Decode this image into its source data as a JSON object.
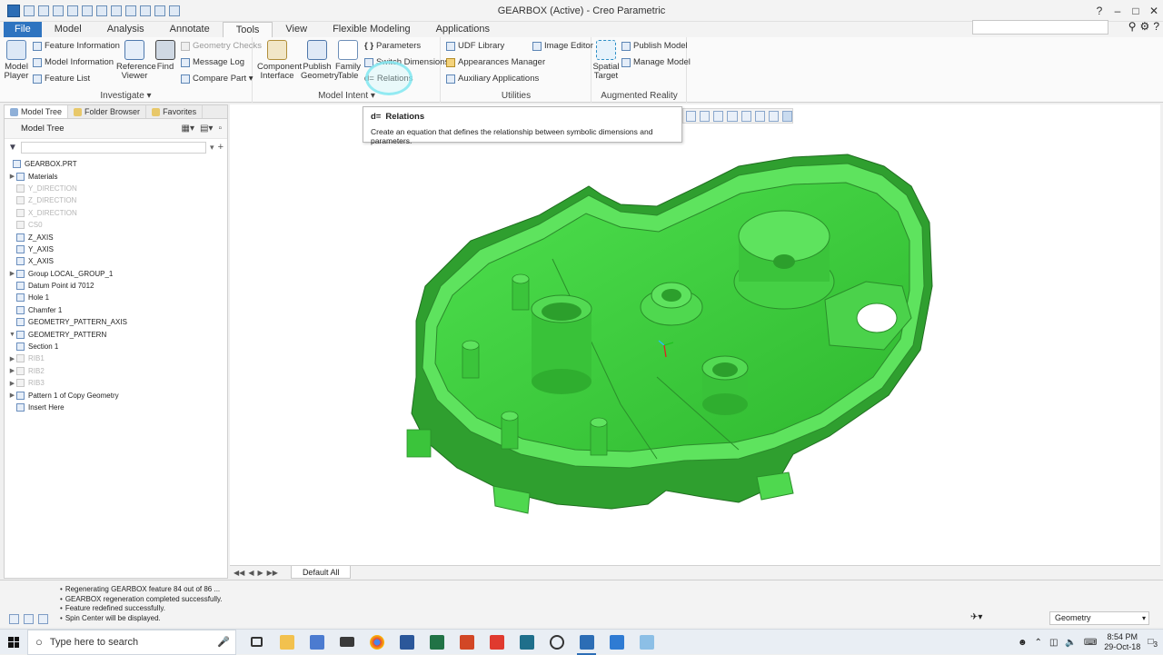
{
  "window": {
    "title": "GEARBOX (Active) - Creo Parametric",
    "controls": [
      "?",
      "–",
      "□",
      "✕"
    ]
  },
  "menu": {
    "tabs": [
      "File",
      "Model",
      "Analysis",
      "Annotate",
      "Tools",
      "View",
      "Flexible Modeling",
      "Applications"
    ],
    "active": "Tools"
  },
  "ribbon": {
    "investigate": {
      "title": "Investigate ▾",
      "model_player": "Model Player",
      "feature_information": "Feature Information",
      "model_information": "Model Information",
      "feature_list": "Feature List",
      "reference_viewer": "Reference Viewer",
      "find": "Find",
      "geometry_checks": "Geometry Checks",
      "message_log": "Message Log",
      "compare_part": "Compare Part ▾"
    },
    "model_intent": {
      "title": "Model Intent ▾",
      "component_interface": "Component Interface",
      "publish_geometry": "Publish Geometry",
      "family_table": "Family Table",
      "parameters": "Parameters",
      "switch_dimensions": "Switch Dimensions",
      "relations": "Relations"
    },
    "utilities": {
      "title": "Utilities",
      "udf_library": "UDF Library",
      "image_editor": "Image Editor",
      "appearances_manager": "Appearances Manager",
      "auxiliary_applications": "Auxiliary Applications"
    },
    "augmented_reality": {
      "title": "Augmented Reality",
      "spatial_target": "Spatial Target",
      "publish_model": "Publish Model",
      "manage_model": "Manage Model"
    }
  },
  "tooltip": {
    "title": "Relations",
    "description": "Create an equation that defines the relationship between symbolic dimensions and parameters."
  },
  "leftpanel": {
    "tabs": [
      "Model Tree",
      "Folder Browser",
      "Favorites"
    ],
    "header": "Model Tree",
    "tree": [
      {
        "label": "GEARBOX.PRT",
        "dim": false,
        "exp": ""
      },
      {
        "label": "Materials",
        "dim": false,
        "exp": "▶"
      },
      {
        "label": "Y_DIRECTION",
        "dim": true,
        "exp": ""
      },
      {
        "label": "Z_DIRECTION",
        "dim": true,
        "exp": ""
      },
      {
        "label": "X_DIRECTION",
        "dim": true,
        "exp": ""
      },
      {
        "label": "CS0",
        "dim": true,
        "exp": ""
      },
      {
        "label": "Z_AXIS",
        "dim": false,
        "exp": ""
      },
      {
        "label": "Y_AXIS",
        "dim": false,
        "exp": ""
      },
      {
        "label": "X_AXIS",
        "dim": false,
        "exp": ""
      },
      {
        "label": "Group LOCAL_GROUP_1",
        "dim": false,
        "exp": "▶"
      },
      {
        "label": "Datum Point id 7012",
        "dim": false,
        "exp": ""
      },
      {
        "label": "Hole 1",
        "dim": false,
        "exp": ""
      },
      {
        "label": "Chamfer 1",
        "dim": false,
        "exp": ""
      },
      {
        "label": "GEOMETRY_PATTERN_AXIS",
        "dim": false,
        "exp": ""
      },
      {
        "label": "GEOMETRY_PATTERN",
        "dim": false,
        "exp": "▼"
      },
      {
        "label": "Section 1",
        "dim": false,
        "exp": ""
      },
      {
        "label": "RIB1",
        "dim": true,
        "exp": "▶"
      },
      {
        "label": "RIB2",
        "dim": true,
        "exp": "▶"
      },
      {
        "label": "RIB3",
        "dim": true,
        "exp": "▶"
      },
      {
        "label": "Pattern 1 of Copy Geometry",
        "dim": false,
        "exp": "▶"
      },
      {
        "label": "Insert Here",
        "dim": false,
        "exp": ""
      }
    ]
  },
  "window_tab": "Default All",
  "messages": [
    "Regenerating GEARBOX feature 84 out of 86 ...",
    "GEARBOX regeneration completed successfully.",
    "Feature redefined successfully.",
    "Spin Center will be displayed."
  ],
  "selection_filter": "Geometry",
  "taskbar": {
    "search_placeholder": "Type here to search",
    "time": "8:54 PM",
    "date": "29-Oct-18",
    "notifications": "3"
  },
  "colors": {
    "model_green": "#3fcb3f",
    "model_dark": "#2a8f2a",
    "accent": "#2e74c0"
  }
}
